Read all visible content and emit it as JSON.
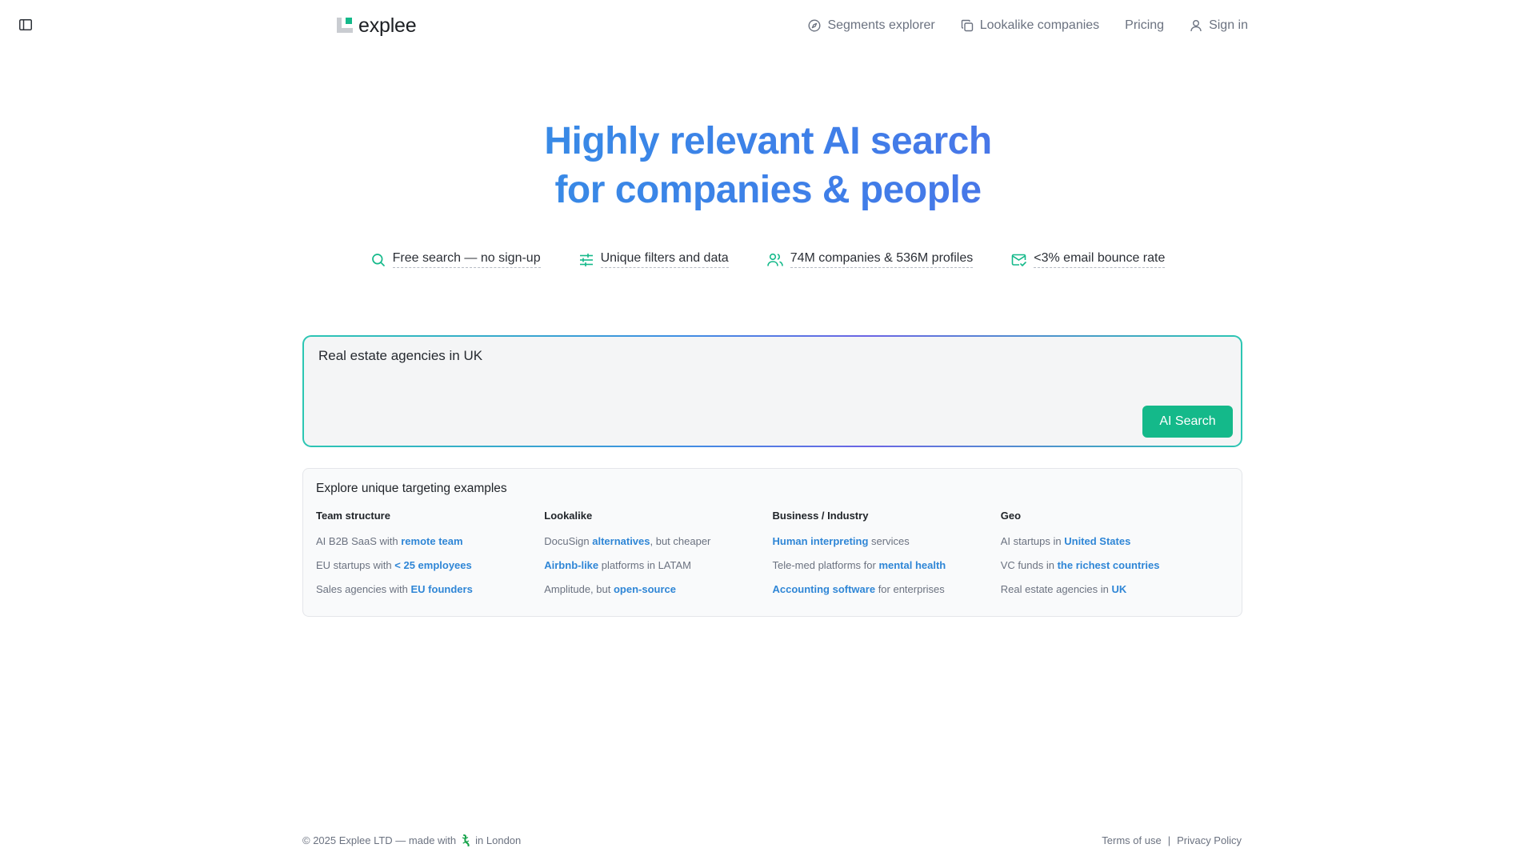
{
  "header": {
    "logo_text": "explee",
    "nav": [
      {
        "label": "Segments explorer",
        "icon": "compass-icon"
      },
      {
        "label": "Lookalike companies",
        "icon": "copy-icon"
      },
      {
        "label": "Pricing"
      },
      {
        "label": "Sign in",
        "icon": "user-icon"
      }
    ]
  },
  "hero": {
    "line1": "Highly relevant AI search",
    "line2": "for companies & people"
  },
  "features": [
    {
      "label": "Free search — no sign-up",
      "icon": "search-icon"
    },
    {
      "label": "Unique filters and data",
      "icon": "sliders-icon"
    },
    {
      "label": "74M companies & 536M profiles",
      "icon": "users-icon"
    },
    {
      "label": "<3% email bounce rate",
      "icon": "mail-check-icon"
    }
  ],
  "search": {
    "value": "Real estate agencies in UK",
    "button_label": "AI Search"
  },
  "examples": {
    "title": "Explore unique targeting examples",
    "columns": [
      {
        "heading": "Team structure",
        "items": [
          {
            "pre": "AI B2B SaaS with ",
            "hl": "remote team",
            "post": ""
          },
          {
            "pre": "EU startups with ",
            "hl": "< 25 employees",
            "post": ""
          },
          {
            "pre": "Sales agencies with ",
            "hl": "EU founders",
            "post": ""
          }
        ]
      },
      {
        "heading": "Lookalike",
        "items": [
          {
            "pre": "DocuSign ",
            "hl": "alternatives",
            "post": ", but cheaper"
          },
          {
            "pre": "",
            "hl": "Airbnb-like",
            "post": " platforms in LATAM"
          },
          {
            "pre": "Amplitude, but ",
            "hl": "open-source",
            "post": ""
          }
        ]
      },
      {
        "heading": "Business / Industry",
        "items": [
          {
            "pre": "",
            "hl": "Human interpreting",
            "post": " services"
          },
          {
            "pre": "Tele-med platforms for ",
            "hl": "mental health",
            "post": ""
          },
          {
            "pre": "",
            "hl": "Accounting software",
            "post": " for enterprises"
          }
        ]
      },
      {
        "heading": "Geo",
        "items": [
          {
            "pre": "AI startups in ",
            "hl": "United States",
            "post": ""
          },
          {
            "pre": "VC funds in ",
            "hl": "the richest countries",
            "post": ""
          },
          {
            "pre": "Real estate agencies in ",
            "hl": "UK",
            "post": ""
          }
        ]
      }
    ]
  },
  "footer": {
    "copyright_pre": "© 2025 Explee LTD — made with",
    "copyright_post": "in London",
    "terms": "Terms of use",
    "separator": "|",
    "privacy": "Privacy Policy"
  },
  "colors": {
    "accent_green": "#14b98a",
    "link_blue": "#2f86d6",
    "gradient_start": "#2c9fe3",
    "gradient_end": "#6a5be6"
  }
}
